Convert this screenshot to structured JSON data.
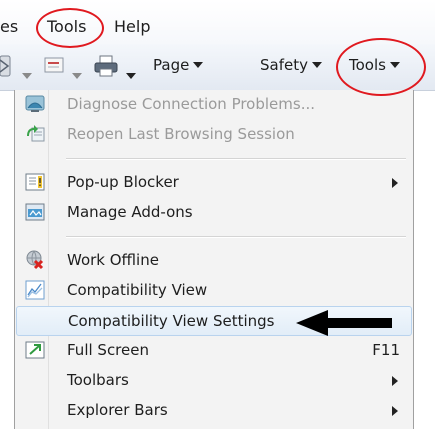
{
  "menubar": {
    "partial_item": "es",
    "tools": "Tools",
    "help": "Help"
  },
  "commandbar": {
    "page": "Page",
    "safety": "Safety",
    "tools": "Tools"
  },
  "menu": {
    "items": [
      {
        "label": "Diagnose Connection Problems...",
        "icon": "diagnose-connection-icon",
        "disabled": true
      },
      {
        "label": "Reopen Last Browsing Session",
        "icon": "reopen-session-icon",
        "disabled": true
      },
      {
        "label": "Pop-up Blocker",
        "icon": "popup-blocker-icon",
        "submenu": true
      },
      {
        "label": "Manage Add-ons",
        "icon": "manage-addons-icon"
      },
      {
        "label": "Work Offline",
        "icon": "work-offline-icon"
      },
      {
        "label": "Compatibility View",
        "icon": "compatibility-view-icon"
      },
      {
        "label": "Compatibility View Settings",
        "highlighted": true
      },
      {
        "label": "Full Screen",
        "icon": "full-screen-icon",
        "shortcut": "F11"
      },
      {
        "label": "Toolbars",
        "submenu": true
      },
      {
        "label": "Explorer Bars",
        "submenu": true
      }
    ]
  },
  "colors": {
    "annotation_red": "#e0191f",
    "highlight": "#e2edf8",
    "menu_bg": "#f3f3f3",
    "disabled_text": "#9a9a9a"
  }
}
